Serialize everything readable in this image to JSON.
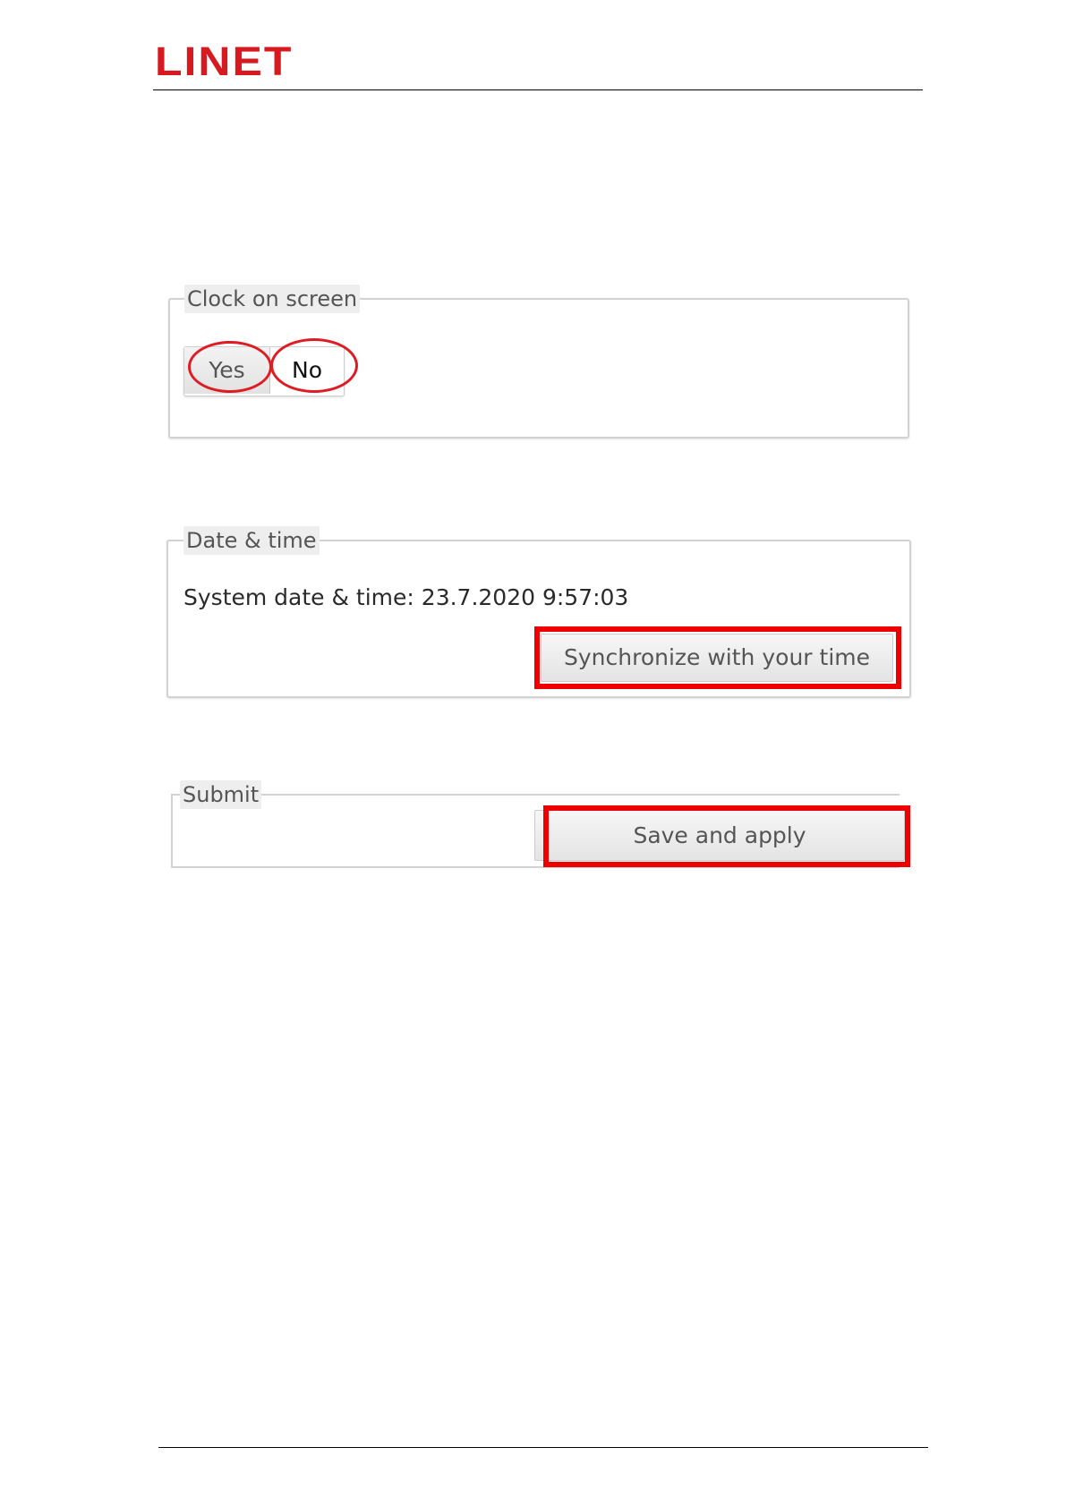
{
  "header": {
    "brand": "LINET"
  },
  "clock_section": {
    "legend": "Clock on screen",
    "yes_label": "Yes",
    "no_label": "No",
    "selected": "No"
  },
  "date_section": {
    "legend": "Date & time",
    "system_time_text": "System date & time: 23.7.2020 9:57:03",
    "sync_button_label": "Synchronize with your time"
  },
  "submit_section": {
    "legend": "Submit",
    "save_button_label": "Save and apply"
  },
  "colors": {
    "brand": "#d71920",
    "highlight": "#ee0000",
    "annotation_circle": "#dd1c24"
  }
}
